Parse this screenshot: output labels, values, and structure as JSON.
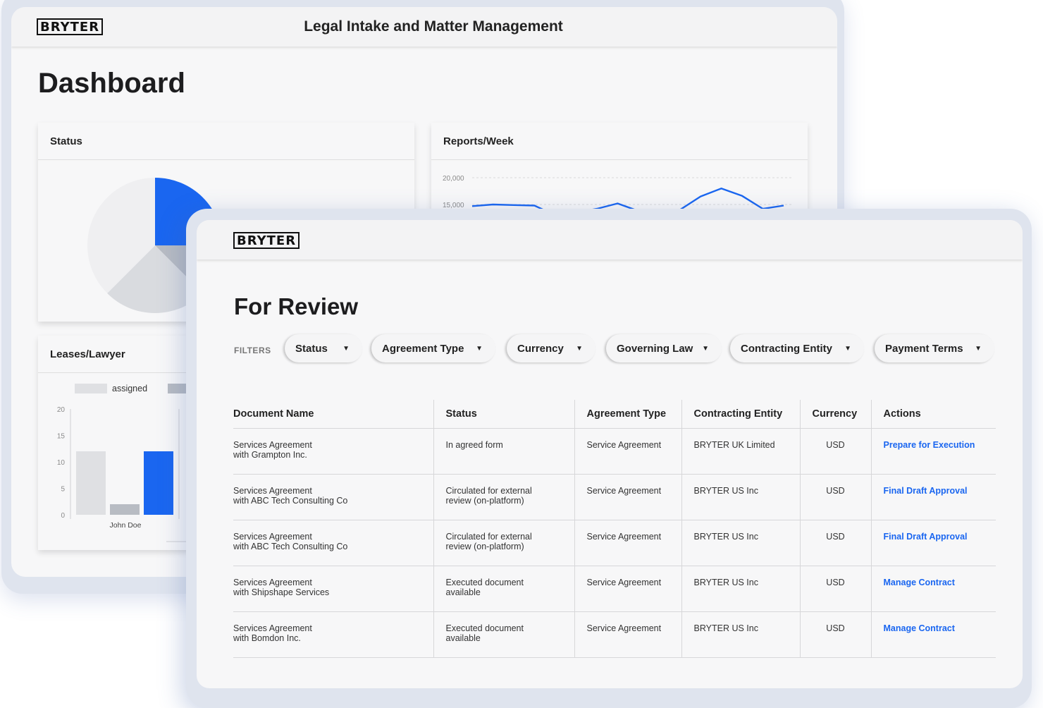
{
  "brand": "BRYTER",
  "dashboard": {
    "app_title": "Legal Intake and Matter Management",
    "heading": "Dashboard",
    "status_card": {
      "title": "Status",
      "slices": [
        {
          "value": 25,
          "color": "#1a66f0"
        },
        {
          "value": 12.5,
          "color": "#b8bcc3"
        },
        {
          "value": 25,
          "color": "#d9dbdf"
        },
        {
          "value": 37.5,
          "color": "#efeff1"
        }
      ]
    },
    "reports_card": {
      "title": "Reports/Week",
      "ticks": [
        "20,000",
        "15,000"
      ]
    },
    "leases_card": {
      "title": "Leases/Lawyer",
      "legend": [
        {
          "label": "assigned",
          "color": "#dfe0e3"
        },
        {
          "label": "",
          "color": "#b8bcc3"
        }
      ],
      "y_ticks": [
        "20",
        "15",
        "10",
        "5",
        "0"
      ],
      "lawyer": "John Doe"
    },
    "colors": {
      "accent": "#1a66f0",
      "grey_light": "#dfe0e3",
      "grey_mid": "#b8bcc3"
    }
  },
  "chart_data": [
    {
      "type": "pie",
      "title": "Status",
      "values": [
        25,
        12.5,
        25,
        37.5
      ]
    },
    {
      "type": "line",
      "title": "Reports/Week",
      "ylim": [
        15000,
        20000
      ],
      "x": [
        1,
        2,
        3,
        4,
        5,
        6,
        7,
        8,
        9,
        10,
        11,
        12,
        13,
        14,
        15,
        16
      ],
      "series": [
        {
          "values": [
            14700,
            15000,
            14900,
            14800,
            13000,
            13500,
            14200,
            15200,
            13800,
            13200,
            14000,
            16500,
            18000,
            16600,
            14200,
            14800
          ]
        }
      ]
    },
    {
      "type": "bar",
      "title": "Leases/Lawyer",
      "categories": [
        "John Doe"
      ],
      "series": [
        {
          "name": "assigned",
          "values": [
            12
          ]
        },
        {
          "name": "",
          "values": [
            2
          ]
        },
        {
          "name": "",
          "values": [
            12
          ]
        }
      ],
      "ylim": [
        0,
        20
      ]
    }
  ],
  "review": {
    "heading": "For Review",
    "filters_label": "FILTERS",
    "filters": [
      "Status",
      "Agreement Type",
      "Currency",
      "Governing Law",
      "Contracting Entity",
      "Payment Terms"
    ],
    "columns": [
      "Document Name",
      "Status",
      "Agreement Type",
      "Contracting Entity",
      "Currency",
      "Actions"
    ],
    "rows": [
      {
        "doc1": "Services Agreement",
        "doc2": "with Grampton Inc.",
        "status1": "In agreed form",
        "status2": "",
        "type": "Service Agreement",
        "entity": "BRYTER UK Limited",
        "currency": "USD",
        "action": "Prepare for Execution"
      },
      {
        "doc1": "Services Agreement",
        "doc2": "with ABC Tech Consulting Co",
        "status1": "Circulated for external",
        "status2": "review (on-platform)",
        "type": "Service Agreement",
        "entity": "BRYTER US Inc",
        "currency": "USD",
        "action": "Final Draft Approval"
      },
      {
        "doc1": "Services Agreement",
        "doc2": "with ABC Tech Consulting Co",
        "status1": "Circulated for external",
        "status2": "review (on-platform)",
        "type": "Service Agreement",
        "entity": "BRYTER US Inc",
        "currency": "USD",
        "action": "Final Draft Approval"
      },
      {
        "doc1": "Services Agreement",
        "doc2": "with Shipshape Services",
        "status1": "Executed document",
        "status2": "available",
        "type": "Service Agreement",
        "entity": "BRYTER US Inc",
        "currency": "USD",
        "action": "Manage Contract"
      },
      {
        "doc1": "Services Agreement",
        "doc2": "with Bomdon Inc.",
        "status1": "Executed document",
        "status2": "available",
        "type": "Service Agreement",
        "entity": "BRYTER US Inc",
        "currency": "USD",
        "action": "Manage Contract"
      }
    ]
  }
}
